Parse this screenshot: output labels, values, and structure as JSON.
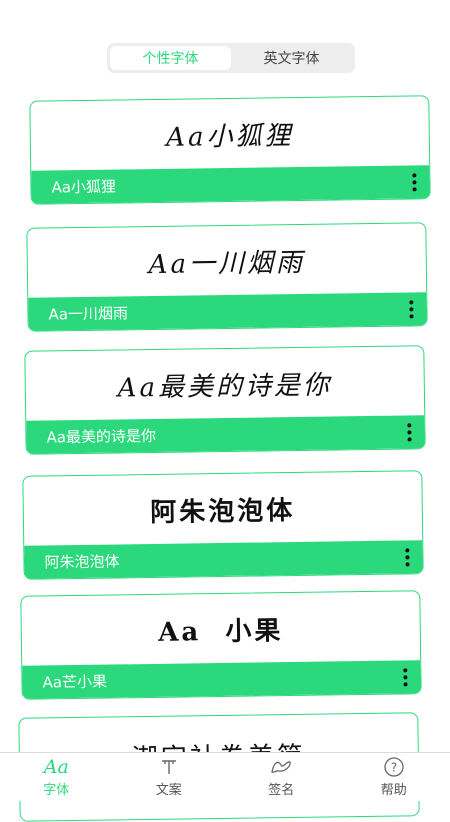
{
  "tabs": [
    {
      "label": "个性字体",
      "active": true
    },
    {
      "label": "英文字体",
      "active": false
    }
  ],
  "fonts": [
    {
      "preview": "Aa小狐狸",
      "name": "Aa小狐狸"
    },
    {
      "preview": "Aa一川烟雨",
      "name": "Aa一川烟雨"
    },
    {
      "preview": "Aa最美的诗是你",
      "name": "Aa最美的诗是你"
    },
    {
      "preview": "阿朱泡泡体",
      "name": "阿朱泡泡体"
    },
    {
      "preview": "Aa  小果",
      "name": "Aa芒小果"
    },
    {
      "preview": "潮字社卷美简",
      "name": ""
    }
  ],
  "nav": [
    {
      "label": "字体",
      "icon": "font-icon",
      "glyph": "Aa",
      "active": true
    },
    {
      "label": "文案",
      "icon": "text-icon",
      "glyph": "",
      "active": false
    },
    {
      "label": "签名",
      "icon": "signature-icon",
      "glyph": "",
      "active": false
    },
    {
      "label": "帮助",
      "icon": "help-icon",
      "glyph": "?",
      "active": false
    }
  ],
  "colors": {
    "accent": "#2bd97c"
  }
}
